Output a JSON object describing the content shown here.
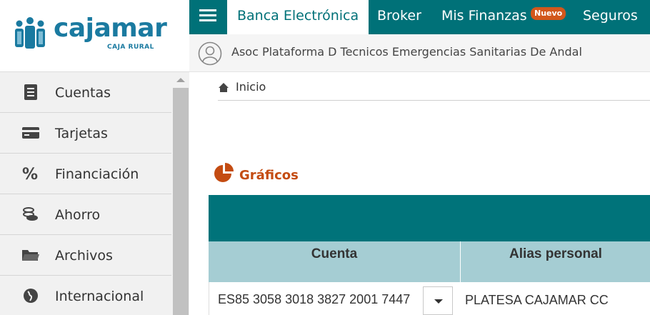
{
  "brand": {
    "name": "cajamar",
    "tagline": "CAJA RURAL",
    "color": "#1a7aa0",
    "icon": "cajamar-people-logo"
  },
  "topnav": {
    "menu_icon": "hamburger-icon",
    "tabs": [
      {
        "label": "Banca Electrónica",
        "active": true
      },
      {
        "label": "Broker",
        "active": false
      },
      {
        "label": "Mis Finanzas",
        "active": false,
        "badge": "Nuevo"
      },
      {
        "label": "Seguros",
        "active": false
      }
    ],
    "color": "#007178",
    "badge_color": "#d2571c"
  },
  "user": {
    "name": "Asoc Plataforma D Tecnicos Emergencias Sanitarias De Andal",
    "icon": "user-avatar-icon"
  },
  "sidebar": {
    "items": [
      {
        "label": "Cuentas",
        "icon": "document-icon"
      },
      {
        "label": "Tarjetas",
        "icon": "credit-card-icon"
      },
      {
        "label": "Financiación",
        "icon": "percent-icon"
      },
      {
        "label": "Ahorro",
        "icon": "piggy-bank-icon"
      },
      {
        "label": "Archivos",
        "icon": "folder-icon"
      },
      {
        "label": "Internacional",
        "icon": "globe-icon"
      }
    ]
  },
  "breadcrumb": {
    "icon": "home-icon",
    "items": [
      "Inicio"
    ]
  },
  "section": {
    "title": "Gráficos",
    "icon": "pie-chart-icon",
    "color": "#c44c12"
  },
  "table": {
    "columns": [
      "Cuenta",
      "Alias personal"
    ],
    "rows": [
      {
        "account": "ES85 3058 3018 3827 2001 7447",
        "alias": "PLATESA CAJAMAR CC"
      }
    ],
    "header_color": "#a5cdd3",
    "band_color": "#00737a"
  }
}
